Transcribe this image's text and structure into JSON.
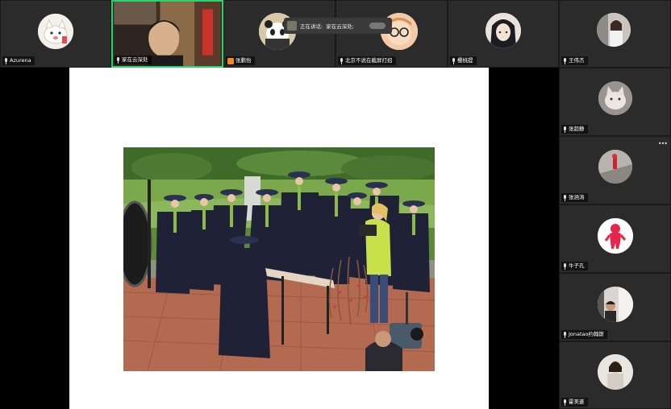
{
  "top_row": [
    {
      "name": "Azurena",
      "mic": "mic",
      "avatar": "cartoon-cat-avatar"
    },
    {
      "name": "家在云深处",
      "mic": "mic",
      "avatar": "live-video",
      "active": true
    },
    {
      "name": "张鹏怡",
      "mic": "video-off",
      "avatar": "panda-avatar"
    },
    {
      "name": "北京不说在截屏打招",
      "mic": "mic",
      "avatar": "glasses-cartoon-avatar"
    },
    {
      "name": "樱桃提",
      "mic": "mic",
      "avatar": "anime-girl-avatar"
    },
    {
      "name": "王伟杰",
      "mic": "mic",
      "avatar": "girl-photo-avatar"
    }
  ],
  "right_column": [
    {
      "name": "张超静",
      "avatar": "cat-photo-avatar"
    },
    {
      "name": "张涵涛",
      "avatar": "red-object-avatar"
    },
    {
      "name": "牛子孔",
      "avatar": "red-figure-avatar"
    },
    {
      "name": "Jonatao约翰斯",
      "avatar": "person-window-avatar"
    },
    {
      "name": "霍美菱",
      "avatar": "woman-photo-avatar"
    }
  ],
  "speaking": {
    "label": "正在讲话:",
    "speaker": "家在云深处;"
  },
  "icons": {
    "mic": "mic-icon",
    "video_off": "video-off-icon",
    "more": "more-icon"
  },
  "colors": {
    "active_border": "#2bd46b",
    "tile_bg": "#2b2b2b",
    "video_off": "#f08a24"
  }
}
